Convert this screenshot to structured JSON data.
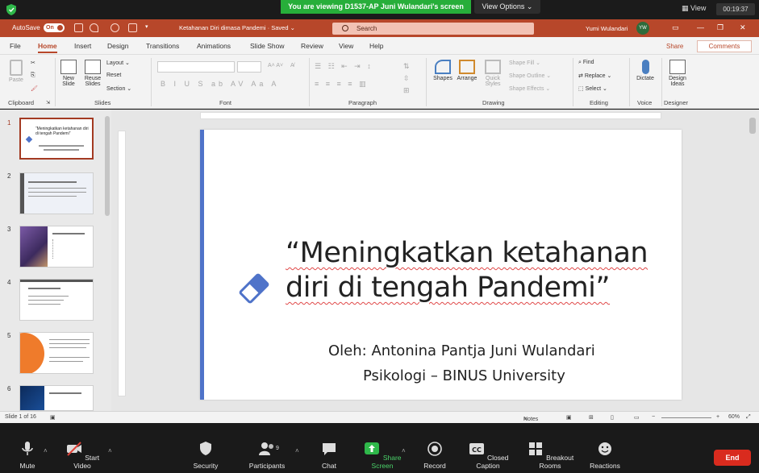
{
  "zoom_top": {
    "banner": "You are viewing D1537-AP Juni Wulandari's screen",
    "view_options": "View Options ⌄",
    "view": "View",
    "timer": "00:19:37"
  },
  "titlebar": {
    "autosave": "AutoSave",
    "toggle": "On",
    "doc_title": "Ketahanan Diri dimasa Pandemi  ·  Saved  ⌄",
    "search_placeholder": "Search",
    "user": "Yumi Wulandari",
    "avatar": "YW"
  },
  "tabs": [
    "File",
    "Home",
    "Insert",
    "Design",
    "Transitions",
    "Animations",
    "Slide Show",
    "Review",
    "View",
    "Help"
  ],
  "share": "Share",
  "comments": "Comments",
  "ribbon": {
    "clipboard": {
      "paste": "Paste",
      "label": "Clipboard"
    },
    "slides": {
      "new_slide": "New Slide",
      "reuse": "Reuse Slides",
      "layout": "Layout ⌄",
      "reset": "Reset",
      "section": "Section ⌄",
      "label": "Slides"
    },
    "font": {
      "label": "Font",
      "buttons": "B  I  U  S  ab  AV  Aa  A"
    },
    "paragraph": {
      "label": "Paragraph"
    },
    "drawing": {
      "shapes": "Shapes",
      "arrange": "Arrange",
      "quick_styles": "Quick Styles",
      "fill": "Shape Fill ⌄",
      "outline": "Shape Outline ⌄",
      "effects": "Shape Effects ⌄",
      "label": "Drawing"
    },
    "editing": {
      "find": "Find",
      "replace": "Replace ⌄",
      "select": "Select ⌄",
      "label": "Editing"
    },
    "voice": {
      "dictate": "Dictate",
      "label": "Voice"
    },
    "designer": {
      "ideas": "Design Ideas",
      "label": "Designer"
    }
  },
  "thumbnails": [
    "1",
    "2",
    "3",
    "4",
    "5",
    "6"
  ],
  "slide": {
    "title_line1": "“Meningkatkan ketahanan",
    "title_line2": "diri di tengah  Pandemi”",
    "author": "Oleh: Antonina Pantja Juni Wulandari",
    "affiliation": "Psikologi – BINUS University"
  },
  "thumb1": {
    "title": "“Meningkatkan ketahanan diri di tengah  Pandemi”"
  },
  "status": {
    "slide_count": "Slide 1 of 16",
    "notes": "Notes",
    "zoom": "60%"
  },
  "zoom_bottom": {
    "mute": "Mute",
    "start_video": "Start Video",
    "security": "Security",
    "participants": "Participants",
    "participants_count": "9",
    "chat": "Chat",
    "share_screen": "Share Screen",
    "record": "Record",
    "cc": "Closed Caption",
    "breakout": "Breakout Rooms",
    "reactions": "Reactions",
    "end": "End"
  }
}
